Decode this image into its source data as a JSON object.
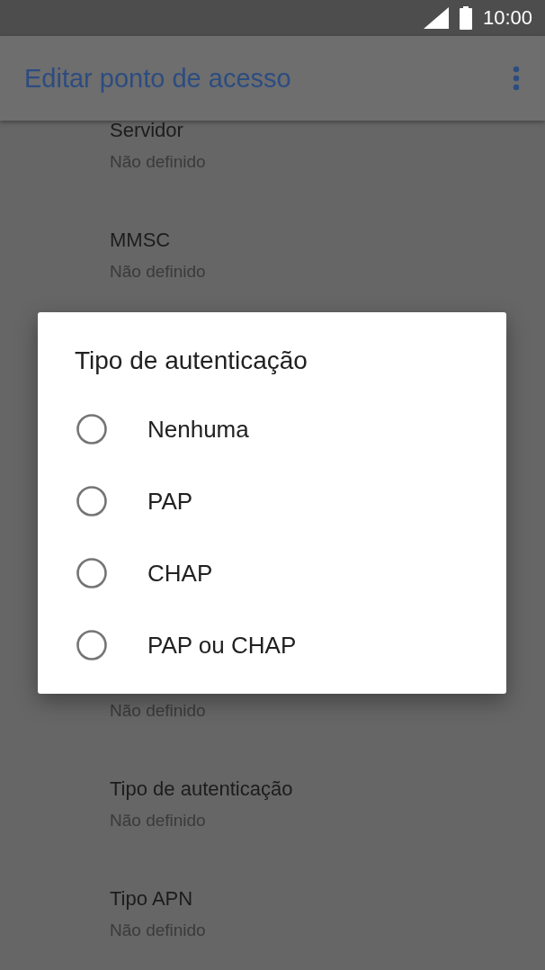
{
  "status_bar": {
    "time": "10:00"
  },
  "app_bar": {
    "title": "Editar ponto de acesso"
  },
  "settings": [
    {
      "title": "Servidor",
      "subtitle": "Não definido"
    },
    {
      "title": "MMSC",
      "subtitle": "Não definido"
    },
    {
      "kind": "partial",
      "subtitle": "Não definido"
    },
    {
      "title": "Tipo de autenticação",
      "subtitle": "Não definido"
    },
    {
      "title": "Tipo APN",
      "subtitle": "Não definido"
    }
  ],
  "dialog": {
    "title": "Tipo de autenticação",
    "options": [
      {
        "label": "Nenhuma",
        "selected": false
      },
      {
        "label": "PAP",
        "selected": false
      },
      {
        "label": "CHAP",
        "selected": false
      },
      {
        "label": "PAP ou CHAP",
        "selected": false
      }
    ]
  }
}
